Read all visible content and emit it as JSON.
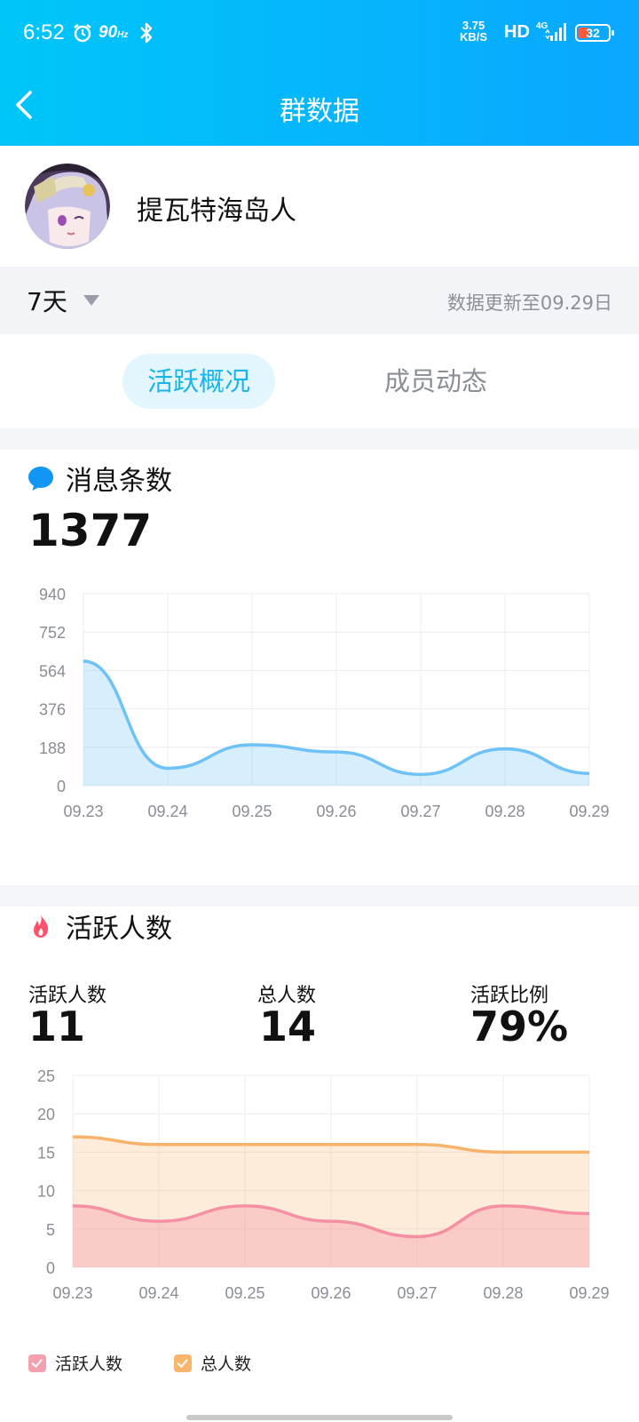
{
  "status_bar": {
    "time": "6:52",
    "refresh_rate": "90",
    "refresh_unit": "Hz",
    "speed_value": "3.75",
    "speed_unit": "KB/S",
    "hd": "HD",
    "network": "4G",
    "battery": "32"
  },
  "header": {
    "title": "群数据"
  },
  "group": {
    "name": "提瓦特海岛人"
  },
  "filter": {
    "range": "7天",
    "updated": "数据更新至09.29日"
  },
  "tabs": [
    {
      "label": "活跃概况",
      "active": true
    },
    {
      "label": "成员动态",
      "active": false
    }
  ],
  "messages": {
    "title": "消息条数",
    "total": "1377"
  },
  "activity": {
    "title": "活跃人数",
    "stats": [
      {
        "label": "活跃人数",
        "value": "11"
      },
      {
        "label": "总人数",
        "value": "14"
      },
      {
        "label": "活跃比例",
        "value": "79%"
      }
    ],
    "legend": [
      {
        "label": "活跃人数",
        "color": "#f4a0ae"
      },
      {
        "label": "总人数",
        "color": "#f8b66c"
      }
    ]
  },
  "colors": {
    "accent": "#19b5e8",
    "msg_line": "#6ec2f7",
    "active_line": "#f590a4",
    "total_line": "#f7b36a"
  },
  "chart_data": [
    {
      "type": "area",
      "categories": [
        "09.23",
        "09.24",
        "09.25",
        "09.26",
        "09.27",
        "09.28",
        "09.29"
      ],
      "series": [
        {
          "values": [
            610,
            85,
            200,
            165,
            55,
            180,
            60
          ]
        }
      ],
      "yticks": [
        0,
        188,
        376,
        564,
        752,
        940
      ],
      "ylim": [
        0,
        940
      ],
      "grid": true
    },
    {
      "type": "area",
      "categories": [
        "09.23",
        "09.24",
        "09.25",
        "09.26",
        "09.27",
        "09.28",
        "09.29"
      ],
      "series": [
        {
          "name": "活跃人数",
          "values": [
            8,
            6,
            8,
            6,
            4,
            8,
            7
          ]
        },
        {
          "name": "总人数",
          "values": [
            17,
            16,
            16,
            16,
            16,
            15,
            15
          ]
        }
      ],
      "yticks": [
        0,
        5,
        10,
        15,
        20,
        25
      ],
      "ylim": [
        0,
        25
      ],
      "grid": true,
      "legend": "bottom-left"
    }
  ]
}
